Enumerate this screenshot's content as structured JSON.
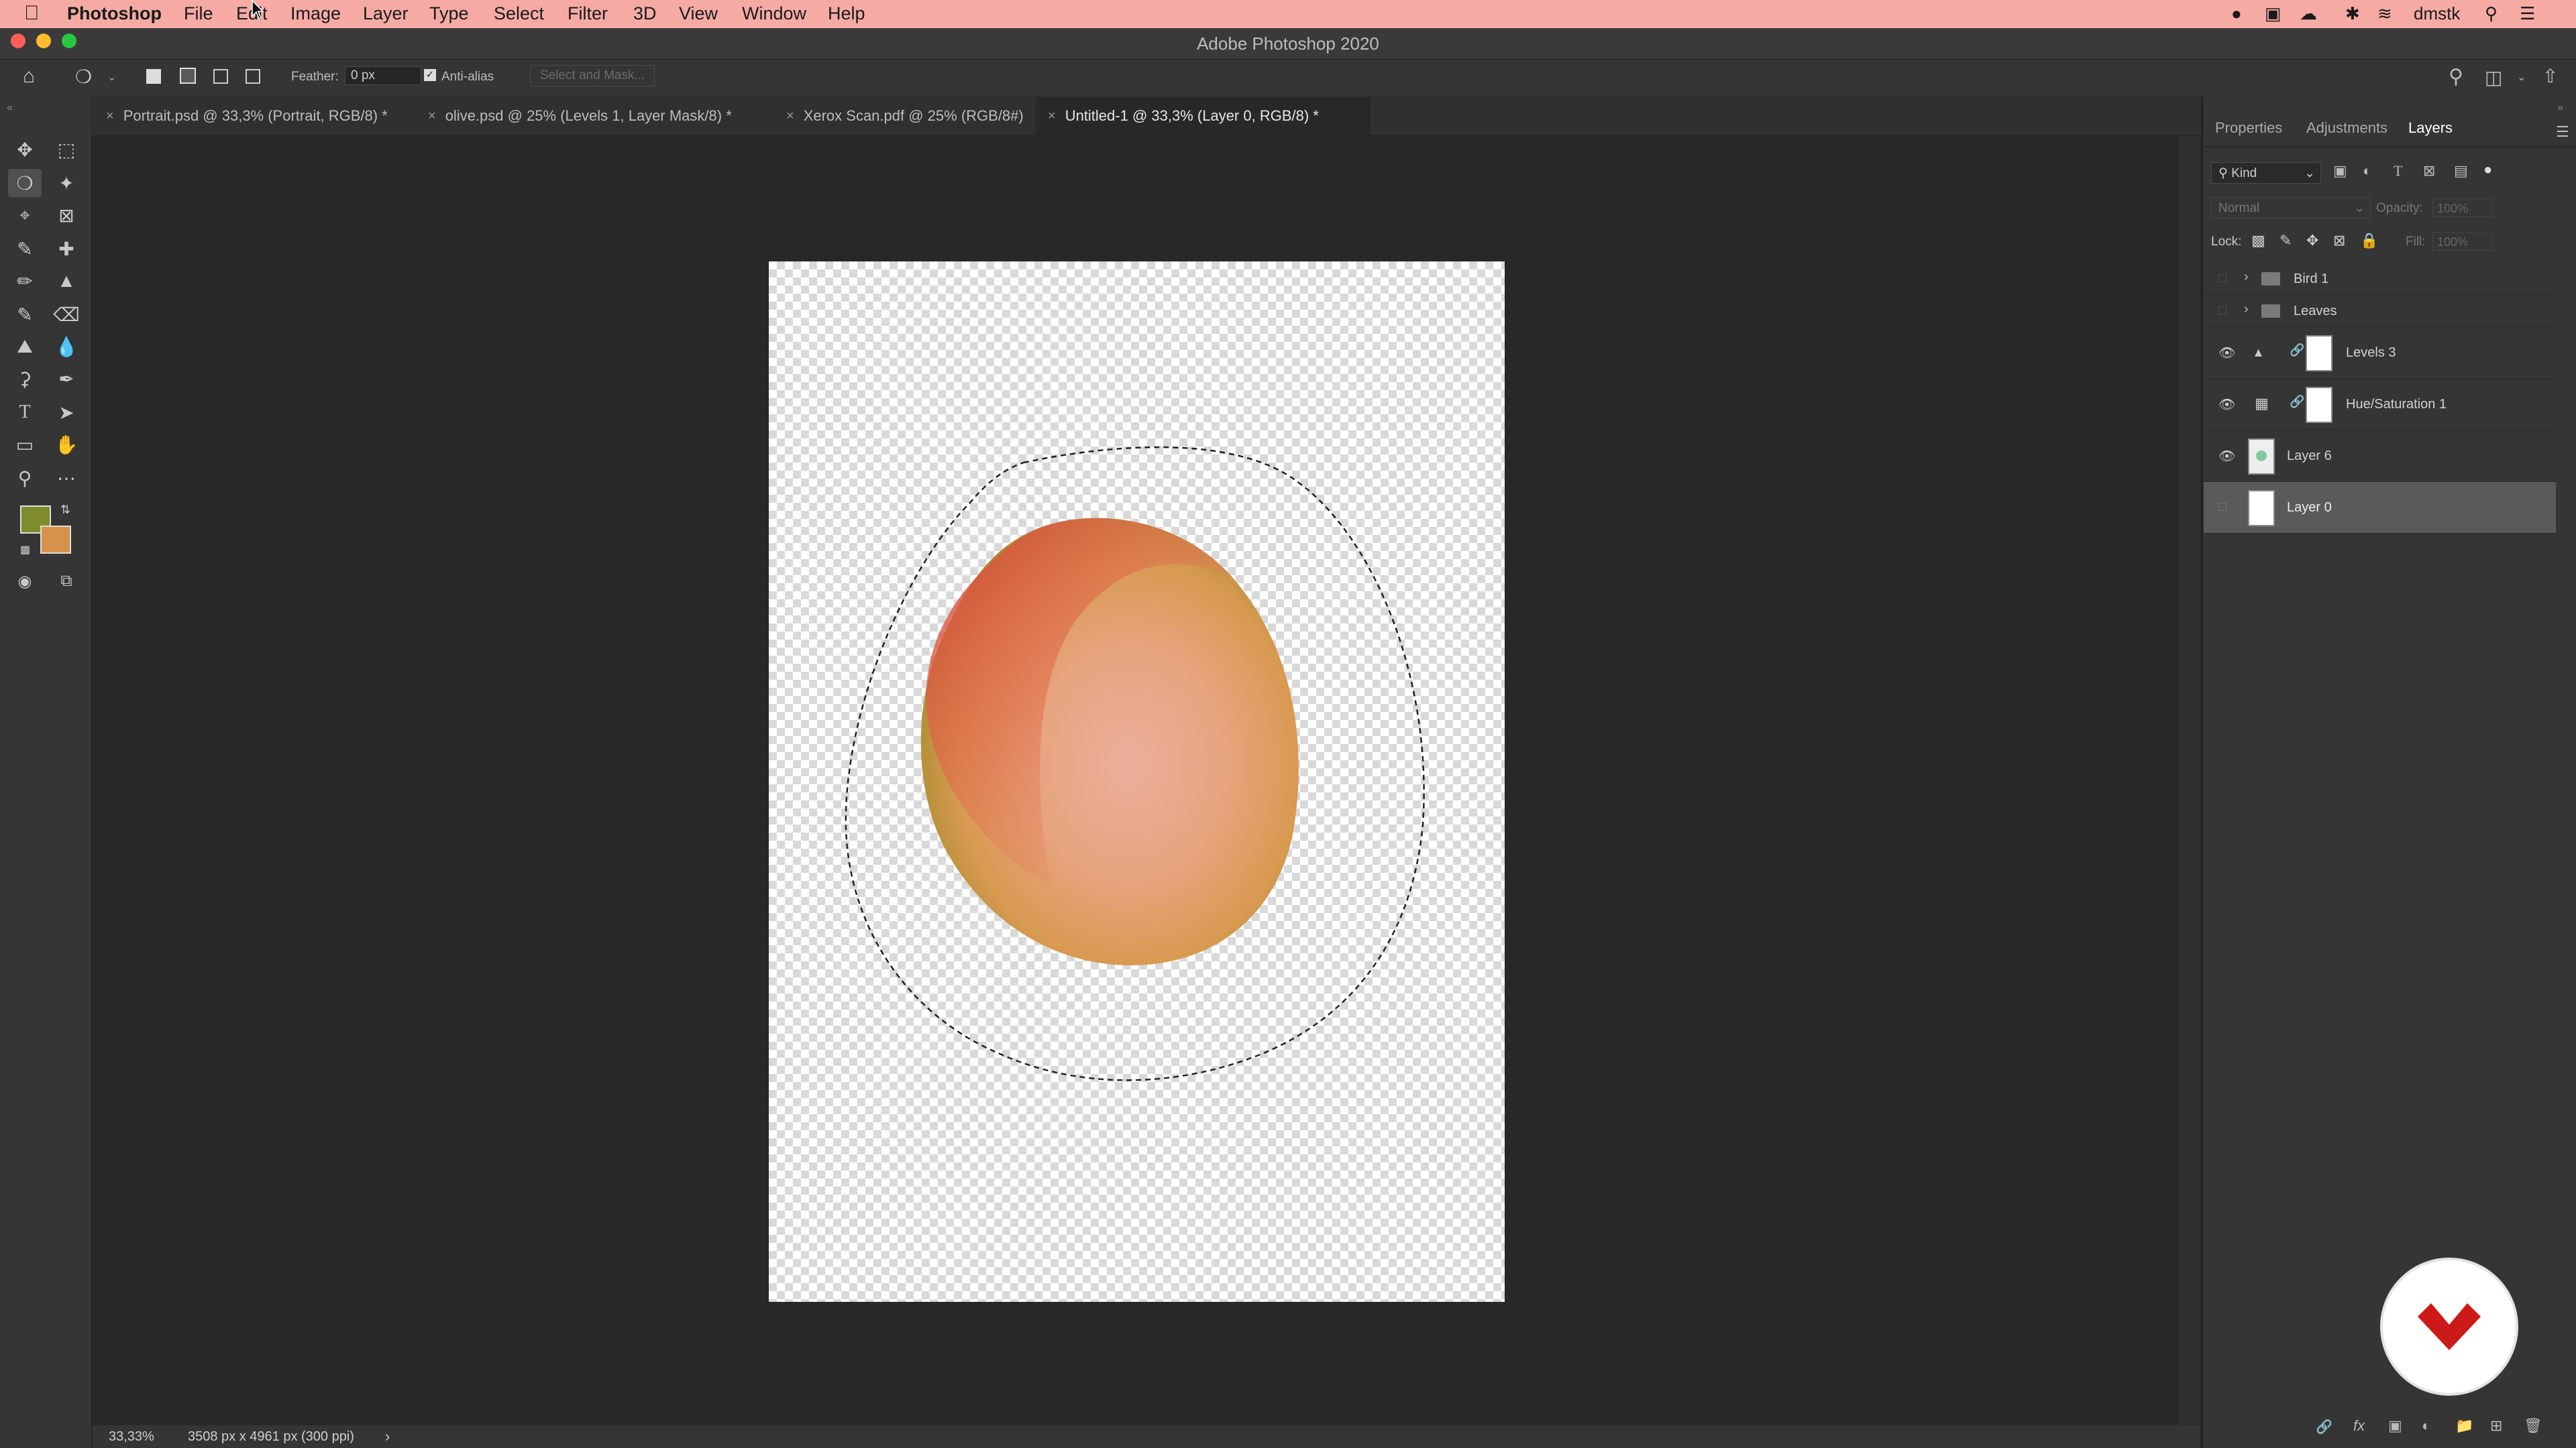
{
  "menubar": {
    "app_name": "Photoshop",
    "menus": [
      "File",
      "Edit",
      "Image",
      "Layer",
      "Type",
      "Select",
      "Filter",
      "3D",
      "View",
      "Window",
      "Help"
    ],
    "user": "dmstk"
  },
  "window": {
    "title": "Adobe Photoshop 2020"
  },
  "options": {
    "feather_label": "Feather:",
    "feather_value": "0 px",
    "antialias_label": "Anti-alias",
    "select_mask": "Select and Mask..."
  },
  "tabs": [
    {
      "label": "Portrait.psd @ 33,3% (Portrait, RGB/8) *"
    },
    {
      "label": "olive.psd @ 25% (Levels 1, Layer Mask/8) *"
    },
    {
      "label": "Xerox Scan.pdf @ 25% (RGB/8#)"
    },
    {
      "label": "Untitled-1 @ 33,3% (Layer 0, RGB/8) *",
      "active": true
    }
  ],
  "status": {
    "zoom": "33,33%",
    "doc_info": "3508 px x 4961 px (300 ppi)"
  },
  "colors": {
    "foreground": "#7f8c2d",
    "background": "#d6924a",
    "menubar": "#f5aba4",
    "accent_logo": "#cc1a1a"
  },
  "panel": {
    "tabs": [
      "Properties",
      "Adjustments",
      "Layers"
    ],
    "kind_label": "Kind",
    "blend_mode": "Normal",
    "opacity_label": "Opacity:",
    "opacity_value": "100%",
    "lock_label": "Lock:",
    "fill_label": "Fill:",
    "fill_value": "100%",
    "layers": [
      {
        "name": "Bird 1",
        "type": "group",
        "visible": false
      },
      {
        "name": "Leaves",
        "type": "group",
        "visible": false
      },
      {
        "name": "Levels 3",
        "type": "adjustment",
        "visible": true
      },
      {
        "name": "Hue/Saturation 1",
        "type": "adjustment",
        "visible": true
      },
      {
        "name": "Layer 6",
        "type": "pixel",
        "visible": true
      },
      {
        "name": "Layer 0",
        "type": "pixel",
        "visible": false,
        "selected": true
      }
    ]
  }
}
